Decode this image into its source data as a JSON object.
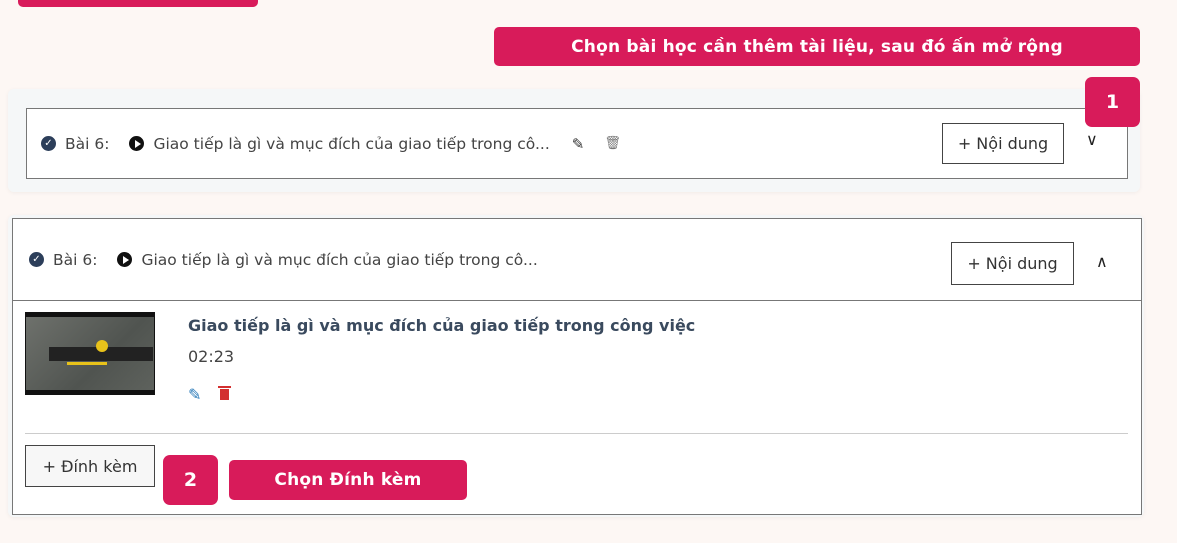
{
  "callouts": {
    "step1_text": "Chọn bài học cần thêm tài liệu, sau đó ấn mở rộng",
    "step1_number": "1",
    "step2_text": "Chọn Đính kèm",
    "step2_number": "2"
  },
  "lesson_collapsed": {
    "label": "Bài 6:",
    "title": "Giao tiếp là gì và mục đích của giao tiếp trong cô...",
    "add_content": "+ Nội dung"
  },
  "lesson_expanded": {
    "label": "Bài 6:",
    "title": "Giao tiếp là gì và mục đích của giao tiếp trong cô...",
    "add_content": "+ Nội dung",
    "video": {
      "title": "Giao tiếp là gì và mục đích của giao tiếp trong công việc",
      "duration": "02:23"
    },
    "attach_label": "+ Đính kèm"
  },
  "colors": {
    "accent": "#d81b5a",
    "edit": "#2a7ab8",
    "delete": "#d32f2f"
  }
}
